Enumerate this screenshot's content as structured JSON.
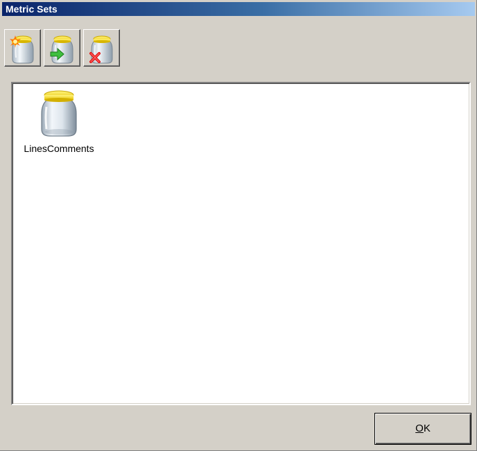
{
  "window": {
    "title": "Metric Sets"
  },
  "toolbar": {
    "buttons": [
      {
        "name": "new-metric-set",
        "icon": "jar-new-icon"
      },
      {
        "name": "import-metric-set",
        "icon": "jar-import-icon"
      },
      {
        "name": "delete-metric-set",
        "icon": "jar-delete-icon"
      }
    ]
  },
  "list": {
    "items": [
      {
        "label": "LinesComments",
        "icon": "jar-icon"
      }
    ]
  },
  "footer": {
    "ok_accel": "O",
    "ok_rest": "K"
  },
  "colors": {
    "title_start": "#0a246a",
    "title_end": "#a6caf0",
    "dialog_face": "#d4d0c8",
    "jar_lid": "#f5d90a"
  }
}
